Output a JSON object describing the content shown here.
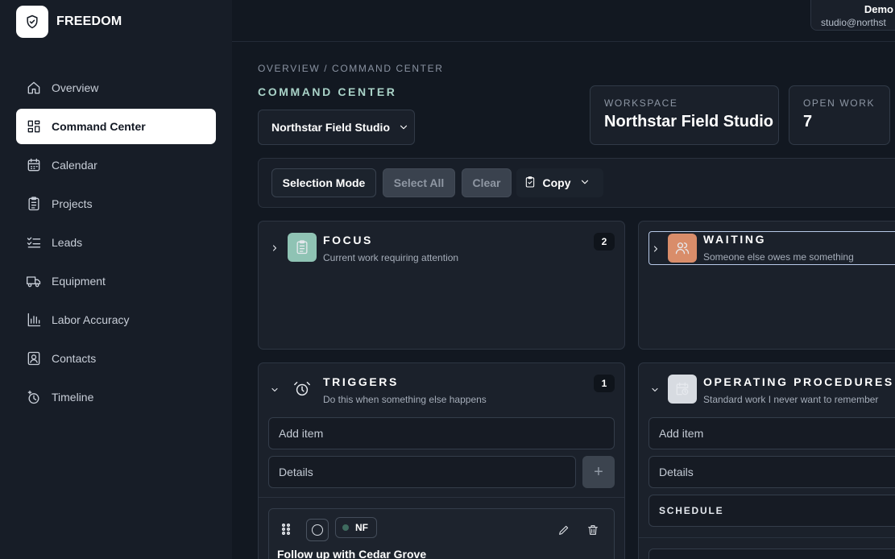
{
  "app": {
    "name": "FREEDOM",
    "logo_icon": "shield-check-icon"
  },
  "user": {
    "name": "Demo",
    "email": "studio@northst"
  },
  "nav": [
    {
      "label": "Overview",
      "icon": "home-icon",
      "active": false
    },
    {
      "label": "Command Center",
      "icon": "grid-icon",
      "active": true
    },
    {
      "label": "Calendar",
      "icon": "calendar-icon",
      "active": false
    },
    {
      "label": "Projects",
      "icon": "clipboard-icon",
      "active": false
    },
    {
      "label": "Leads",
      "icon": "checklist-icon",
      "active": false
    },
    {
      "label": "Equipment",
      "icon": "truck-icon",
      "active": false
    },
    {
      "label": "Labor Accuracy",
      "icon": "bar-chart-icon",
      "active": false
    },
    {
      "label": "Contacts",
      "icon": "contact-icon",
      "active": false
    },
    {
      "label": "Timeline",
      "icon": "timeline-icon",
      "active": false
    }
  ],
  "main": {
    "breadcrumb": "OVERVIEW / COMMAND CENTER",
    "title": "COMMAND CENTER",
    "workspace_select": "Northstar Field Studio",
    "stats": [
      {
        "label": "WORKSPACE",
        "value": "Northstar Field Studio"
      },
      {
        "label": "OPEN WORK",
        "value": "7"
      }
    ],
    "toolbar": {
      "selection_mode": "Selection Mode",
      "select_all": "Select All",
      "clear": "Clear",
      "copy": "Copy"
    },
    "sections": {
      "focus": {
        "title": "FOCUS",
        "subtitle": "Current work requiring attention",
        "count": "2",
        "color": "#8fc3b4"
      },
      "waiting": {
        "title": "WAITING",
        "subtitle": "Someone else owes me something",
        "color": "#d98d6a"
      },
      "triggers": {
        "title": "TRIGGERS",
        "subtitle": "Do this when something else happens",
        "count": "1",
        "add_placeholder": "Add item",
        "details_placeholder": "Details",
        "item": {
          "tag": "NF",
          "title": "Follow up with Cedar Grove"
        }
      },
      "procedures": {
        "title": "OPERATING PROCEDURES",
        "subtitle": "Standard work I never want to remember",
        "color": "#d7dbe1",
        "add_placeholder": "Add item",
        "details_placeholder": "Details",
        "schedule": "SCHEDULE"
      }
    }
  }
}
